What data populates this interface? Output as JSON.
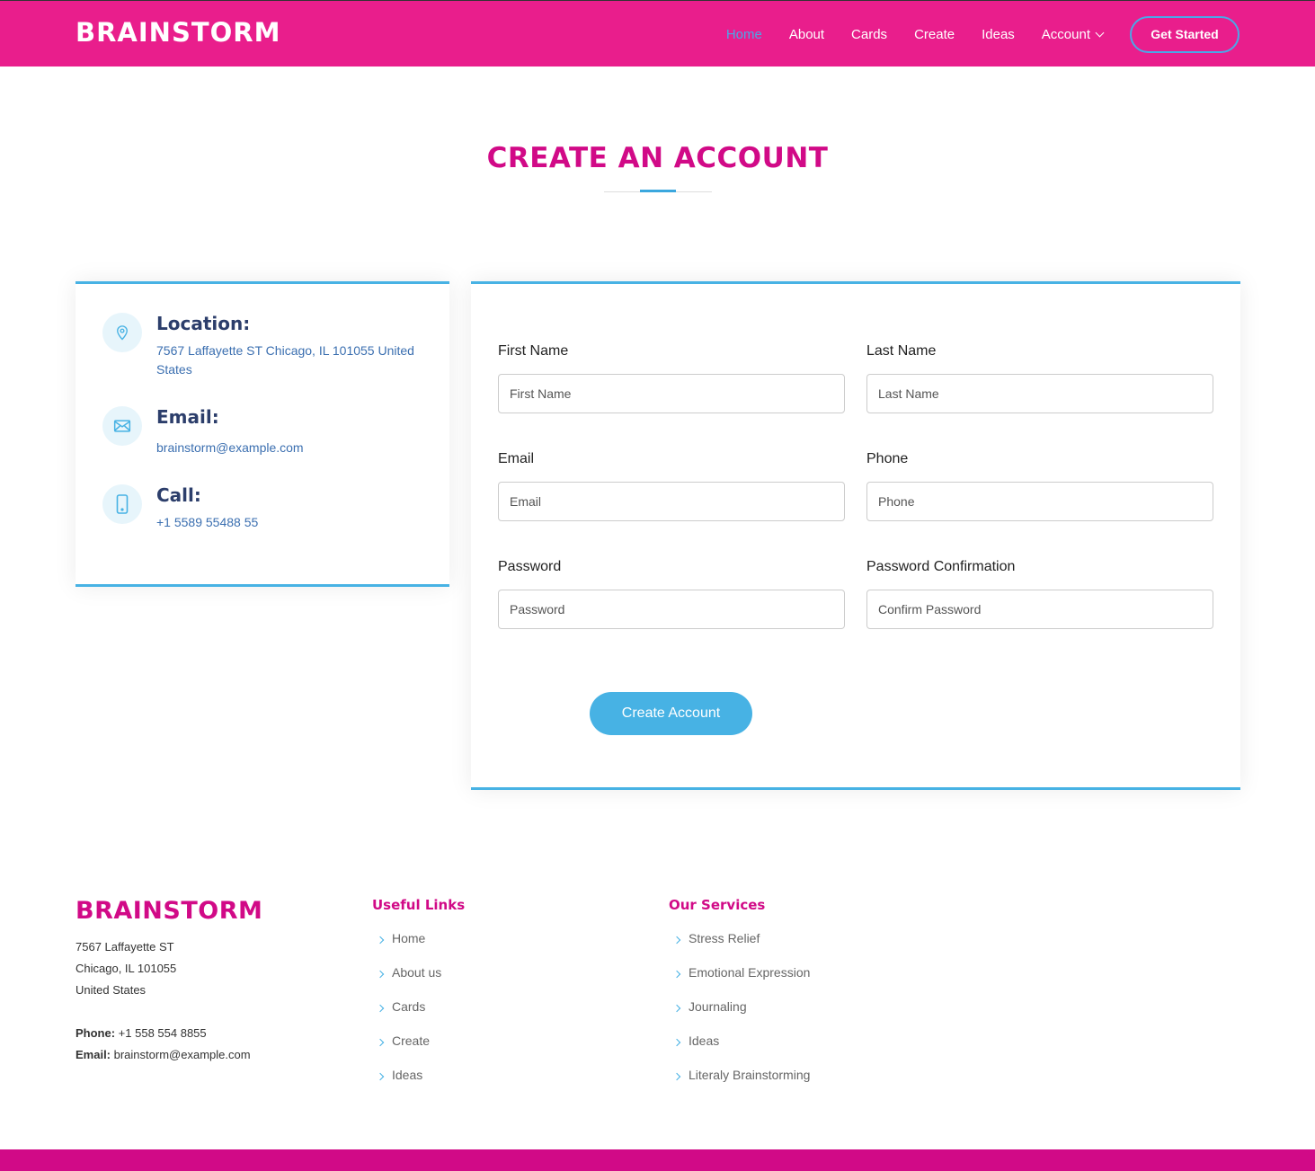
{
  "header": {
    "logo": "BRAINSTORM",
    "nav": [
      {
        "label": "Home",
        "active": true
      },
      {
        "label": "About"
      },
      {
        "label": "Cards"
      },
      {
        "label": "Create"
      },
      {
        "label": "Ideas"
      },
      {
        "label": "Account",
        "has_dropdown": true
      }
    ],
    "cta_label": "Get Started"
  },
  "section": {
    "title": "CREATE AN ACCOUNT"
  },
  "info": {
    "location": {
      "heading": "Location:",
      "text": "7567 Laffayette ST Chicago, IL 101055 United States",
      "icon": "map-pin-icon"
    },
    "email": {
      "heading": "Email:",
      "text": "brainstorm@example.com",
      "icon": "envelope-icon"
    },
    "call": {
      "heading": "Call:",
      "text": "+1 5589 55488 55",
      "icon": "phone-icon"
    }
  },
  "form": {
    "first_name": {
      "label": "First Name",
      "placeholder": "First Name"
    },
    "last_name": {
      "label": "Last Name",
      "placeholder": "Last Name"
    },
    "email": {
      "label": "Email",
      "placeholder": "Email"
    },
    "phone": {
      "label": "Phone",
      "placeholder": "Phone"
    },
    "password": {
      "label": "Password",
      "placeholder": "Password"
    },
    "password_confirmation": {
      "label": "Password Confirmation",
      "placeholder": "Confirm Password"
    },
    "submit_label": "Create Account"
  },
  "footer": {
    "logo": "BRAINSTORM",
    "address_line1": "7567 Laffayette ST",
    "address_line2": "Chicago, IL 101055",
    "address_line3": "United States",
    "phone_label": "Phone:",
    "phone_value": " +1 558 554 8855",
    "email_label": "Email:",
    "email_value": " brainstorm@example.com",
    "useful_links": {
      "title": "Useful Links",
      "items": [
        "Home",
        "About us",
        "Cards",
        "Create",
        "Ideas"
      ]
    },
    "services": {
      "title": "Our Services",
      "items": [
        "Stress Relief",
        "Emotional Expression",
        "Journaling",
        "Ideas",
        "Literaly Brainstorming"
      ]
    }
  },
  "colors": {
    "header_bg": "#e91e8c",
    "brand_pink": "#d10a87",
    "accent_blue": "#47b2e4",
    "nav_active": "#4aa8e8"
  }
}
